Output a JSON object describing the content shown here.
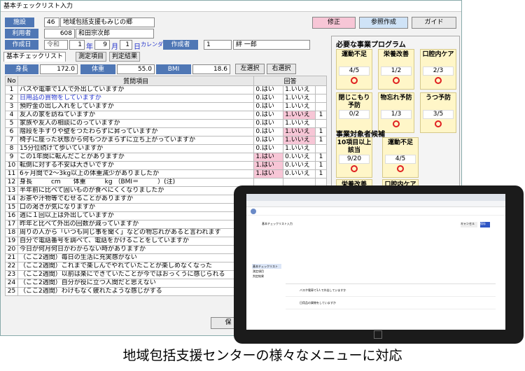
{
  "window": {
    "title": "基本チェックリスト入力"
  },
  "header": {
    "facility_label": "施設",
    "facility_code": "46",
    "facility_name": "地域包括支援もみじの郷",
    "user_label": "利用者",
    "user_code": "608",
    "user_name": "和田宗次郎",
    "date_label": "作成日",
    "era": "令和",
    "year": "1",
    "year_unit": "年",
    "month": "9",
    "month_unit": "月",
    "day": "1",
    "day_unit": "日",
    "calendar_label": "カレンダー",
    "author_label": "作成者",
    "author_code": "1",
    "author_name": "絆 一郎"
  },
  "toolbar": {
    "edit": "修正",
    "reference": "参照作成",
    "guide": "ガイド"
  },
  "tabs": {
    "main": "基本チェックリスト",
    "items": "測定項目",
    "result": "判定結果"
  },
  "measure": {
    "height_label": "身長",
    "height": "172.0",
    "weight_label": "体重",
    "weight": "55.0",
    "bmi_label": "BMI",
    "bmi": "18.6",
    "left_select": "左選択",
    "right_select": "右選択"
  },
  "table": {
    "headers": {
      "no": "No",
      "question": "質問項目",
      "answer": "回答"
    },
    "rows": [
      {
        "no": "1",
        "q": "バスや電車で1人で外出していますか",
        "a": "0.はい",
        "b": "1.いいえ",
        "n": ""
      },
      {
        "no": "2",
        "q": "日用品の買物をしていますか",
        "a": "0.はい",
        "b": "1.いいえ",
        "n": ""
      },
      {
        "no": "3",
        "q": "預貯金の出し入れをしていますか",
        "a": "0.はい",
        "b": "1.いいえ",
        "n": ""
      },
      {
        "no": "4",
        "q": "友人の家を訪ねていますか",
        "a": "0.はい",
        "b": "1.いいえ",
        "n": "1"
      },
      {
        "no": "5",
        "q": "家族や友人の相談にのっていますか",
        "a": "0.はい",
        "b": "1.いいえ",
        "n": ""
      },
      {
        "no": "6",
        "q": "階段を手すりや壁をつたわらずに昇っていますか",
        "a": "0.はい",
        "b": "1.いいえ",
        "n": "1"
      },
      {
        "no": "7",
        "q": "椅子に座った状態から何もつかまらずに立ち上がっていますか",
        "a": "0.はい",
        "b": "1.いいえ",
        "n": "1"
      },
      {
        "no": "8",
        "q": "15分位続けて歩いていますか",
        "a": "0.はい",
        "b": "1.いいえ",
        "n": ""
      },
      {
        "no": "9",
        "q": "この1年間に転んだことがありますか",
        "a": "1.はい",
        "b": "0.いいえ",
        "n": "1"
      },
      {
        "no": "10",
        "q": "転倒に対する不安は大きいですか",
        "a": "1.はい",
        "b": "0.いいえ",
        "n": "1"
      },
      {
        "no": "11",
        "q": "6ヶ月間で2～3kg以上の体重減少がありましたか",
        "a": "1.はい",
        "b": "0.いいえ",
        "n": "1"
      },
      {
        "no": "12",
        "q": "身長　　　cm　　体重　　　kg （BMI＝　　　）(注)",
        "a": "",
        "b": "",
        "n": ""
      },
      {
        "no": "13",
        "q": "半年前に比べて固いものが食べにくくなりましたか",
        "a": "",
        "b": "",
        "n": ""
      },
      {
        "no": "14",
        "q": "お茶や汁物等でむせることがありますか",
        "a": "",
        "b": "",
        "n": ""
      },
      {
        "no": "15",
        "q": "口の渇きが気になりますか",
        "a": "",
        "b": "",
        "n": ""
      },
      {
        "no": "16",
        "q": "週に１回以上は外出していますか",
        "a": "",
        "b": "",
        "n": ""
      },
      {
        "no": "17",
        "q": "昨年と比べて外出の回数が減っていますか",
        "a": "",
        "b": "",
        "n": ""
      },
      {
        "no": "18",
        "q": "周りの人から「いつも同じ事を聞く」などの物忘れがあると言われます",
        "a": "",
        "b": "",
        "n": ""
      },
      {
        "no": "19",
        "q": "自分で電話番号を調べて、電話をかけることをしていますか",
        "a": "",
        "b": "",
        "n": ""
      },
      {
        "no": "20",
        "q": "今日が何月何日かわからない時がありますか",
        "a": "",
        "b": "",
        "n": ""
      },
      {
        "no": "21",
        "q": "（ここ2週間）毎日の生活に充実感がない",
        "a": "",
        "b": "",
        "n": ""
      },
      {
        "no": "22",
        "q": "（ここ2週間）これまで楽しんでやれていたことが楽しめなくなった",
        "a": "",
        "b": "",
        "n": ""
      },
      {
        "no": "23",
        "q": "（ここ2週間）以前は楽にできていたことが今ではおっくうに感じられる",
        "a": "",
        "b": "",
        "n": ""
      },
      {
        "no": "24",
        "q": "（ここ2週間）自分が役に立つ人間だと思えない",
        "a": "",
        "b": "",
        "n": ""
      },
      {
        "no": "25",
        "q": "（ここ2週間）わけもなく疲れたような感じがする",
        "a": "",
        "b": "",
        "n": ""
      }
    ]
  },
  "programs": {
    "title": "必要な事業プログラム",
    "items": [
      {
        "name": "運動不足",
        "score": "4/5"
      },
      {
        "name": "栄養改善",
        "score": "1/2"
      },
      {
        "name": "口腔内ケア",
        "score": "2/3"
      },
      {
        "name": "閉じこもり予防",
        "score": "0/2"
      },
      {
        "name": "物忘れ予防",
        "score": "1/3"
      },
      {
        "name": "うつ予防",
        "score": "3/5"
      }
    ]
  },
  "candidates": {
    "title": "事業対象者候補",
    "items": [
      {
        "name": "10項目以上該当",
        "score": "9/20"
      },
      {
        "name": "運動不足",
        "score": "4/5"
      },
      {
        "name": "栄養改善",
        "score": ""
      },
      {
        "name": "口腔内ケア",
        "score": ""
      }
    ]
  },
  "save_button": "保",
  "tablet": {
    "app_title": "基本チェックリスト入力",
    "sidebar": [
      "基本チェックリスト",
      "測定項目",
      "判定結果"
    ],
    "cancel": "キャンセル",
    "save": "保存",
    "row1": "バスや電車で1人で外出していますか",
    "row2": "日用品の買物をしていますか"
  },
  "caption": "地域包括支援センターの様々なメニューに対応"
}
